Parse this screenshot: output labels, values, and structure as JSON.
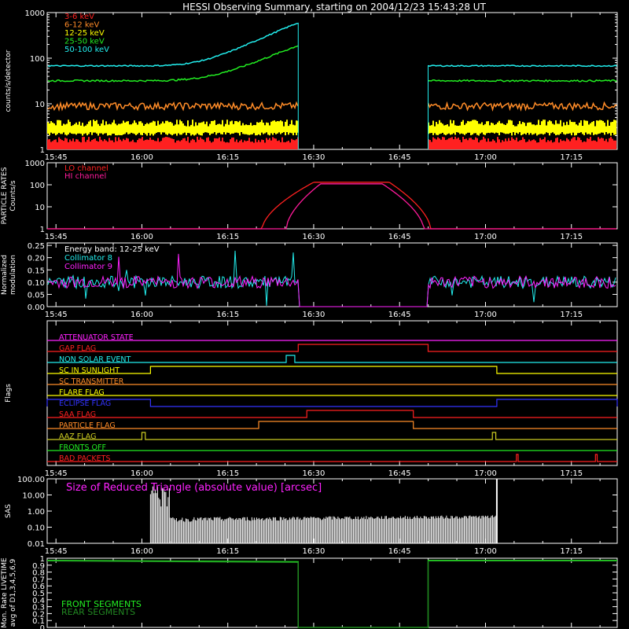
{
  "title": "HESSI Observing Summary, starting on 2004/12/23 15:43:28 UT",
  "time_ticks": [
    "15:45",
    "16:00",
    "16:15",
    "16:30",
    "16:45",
    "17:00",
    "17:15"
  ],
  "colors": {
    "bg": "#000000",
    "axis": "#ffffff"
  },
  "chart_data": [
    {
      "type": "line",
      "name": "count-rates",
      "ylabel": "counts/s/detector",
      "yscale": "log",
      "ylim": [
        1,
        1000
      ],
      "yticks": [
        "1",
        "10",
        "100",
        "1000"
      ],
      "xlim": [
        15.7244,
        17.3833
      ],
      "gap": [
        16.455,
        16.833
      ],
      "series": [
        {
          "name": "3-6 keV",
          "color": "#ff2020",
          "level": 1.5,
          "rise_to": null
        },
        {
          "name": "6-12 keV",
          "color": "#ff8c28",
          "level": 9,
          "rise_to": null
        },
        {
          "name": "12-25 keV",
          "color": "#ffff00",
          "level": 3.2,
          "rise_to": null
        },
        {
          "name": "25-50 keV",
          "color": "#22ee22",
          "level": 35,
          "rise_to": 190
        },
        {
          "name": "50-100 keV",
          "color": "#22eeee",
          "level": 70,
          "rise_to": 600
        }
      ]
    },
    {
      "type": "line",
      "name": "particle-rates",
      "ylabel": "PARTICLE RATES\nCounts/s",
      "yscale": "log",
      "ylim": [
        1,
        1000
      ],
      "yticks": [
        "1",
        "10",
        "100",
        "1000"
      ],
      "series": [
        {
          "name": "LO channel",
          "color": "#ff2020",
          "peak": 130
        },
        {
          "name": "HI channel",
          "color": "#ff1a9a",
          "peak": 110
        }
      ]
    },
    {
      "type": "line",
      "name": "modulation",
      "ylabel": "Normalized\nmodulation",
      "ylim": [
        0,
        0.26
      ],
      "yticks": [
        "0.00",
        "0.05",
        "0.10",
        "0.15",
        "0.20",
        "0.25"
      ],
      "annotation": "Energy band: 12-25 keV",
      "series": [
        {
          "name": "Collimator 8",
          "color": "#22eeee",
          "level": 0.1
        },
        {
          "name": "Collimator 9",
          "color": "#ff22ff",
          "level": 0.1
        }
      ]
    },
    {
      "type": "line",
      "name": "flags",
      "ylabel": "Flags",
      "series": [
        {
          "name": "ATTENUATOR STATE",
          "color": "#ff22ff",
          "on": []
        },
        {
          "name": "GAP FLAG",
          "color": "#ff2020",
          "on": [
            [
              16.455,
              16.833
            ]
          ]
        },
        {
          "name": "NON SOLAR EVENT",
          "color": "#22eeee",
          "on": [
            [
              16.42,
              16.445
            ]
          ]
        },
        {
          "name": "SC IN SUNLIGHT",
          "color": "#ffff00",
          "on": [
            [
              16.025,
              17.033
            ]
          ]
        },
        {
          "name": "SC TRANSMITTER",
          "color": "#ff8c28",
          "on": []
        },
        {
          "name": "FLARE FLAG",
          "color": "#ffff00",
          "on": []
        },
        {
          "name": "ECLIPSE FLAG",
          "color": "#3333ff",
          "on": [
            [
              15.7244,
              16.025
            ],
            [
              17.033,
              17.3833
            ]
          ]
        },
        {
          "name": "SAA FLAG",
          "color": "#ff2020",
          "on": [
            [
              16.48,
              16.79
            ]
          ]
        },
        {
          "name": "PARTICLE FLAG",
          "color": "#ff8c28",
          "on": [
            [
              16.34,
              16.79
            ]
          ]
        },
        {
          "name": "AAZ FLAG",
          "color": "#cccc22",
          "on": [
            [
              16.0,
              16.01
            ],
            [
              17.02,
              17.03
            ]
          ]
        },
        {
          "name": "FRONTS OFF",
          "color": "#22ee22",
          "on": []
        },
        {
          "name": "BAD PACKETS",
          "color": "#ff2020",
          "on": [
            [
              17.09,
              17.095
            ],
            [
              17.32,
              17.325
            ]
          ]
        }
      ]
    },
    {
      "type": "line",
      "name": "sas",
      "ylabel": "SAS",
      "yscale": "log",
      "ylim": [
        0.01,
        100
      ],
      "yticks": [
        "0.01",
        "0.10",
        "1.00",
        "10.00",
        "100.00"
      ],
      "annotation": "Size of Reduced Triangle (absolute value) [arcsec]",
      "series": [
        {
          "name": "triangle",
          "color": "#ffffff",
          "active": [
            16.025,
            17.033
          ]
        }
      ]
    },
    {
      "type": "line",
      "name": "livetime",
      "ylabel": "Mon. Rate LIVETIME\navg of D1,3,4,5,6,9",
      "ylim": [
        0,
        1
      ],
      "yticks": [
        "0",
        "0.1",
        "0.2",
        "0.3",
        "0.4",
        "0.5",
        "0.6",
        "0.7",
        "0.8",
        "0.9",
        "1"
      ],
      "series": [
        {
          "name": "FRONT SEGMENTS",
          "color": "#22ee22",
          "level": 0.97
        },
        {
          "name": "REAR SEGMENTS",
          "color": "#228822",
          "level": 0.96
        }
      ]
    }
  ]
}
